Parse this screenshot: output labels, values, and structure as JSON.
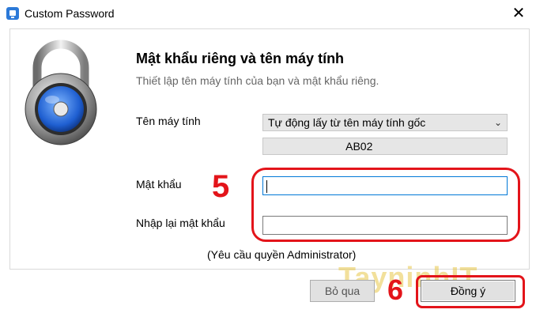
{
  "window": {
    "title": "Custom Password",
    "close_label": "✕"
  },
  "header": {
    "title": "Mật khẩu riêng và tên máy tính",
    "subtitle": "Thiết lập tên máy tính của bạn và mật khẩu riêng."
  },
  "form": {
    "computer_name_label": "Tên máy tính",
    "computer_name_option": "Tự động lấy từ tên máy tính gốc",
    "computer_name_value": "AB02",
    "password_label": "Mật khẩu",
    "password_value": "",
    "confirm_label": "Nhập lại mật khẩu",
    "confirm_value": "",
    "note": "(Yêu cầu quyền Administrator)"
  },
  "annotations": {
    "step5": "5",
    "step6": "6",
    "watermark": "TayninhIT",
    "color": "#e3141a"
  },
  "buttons": {
    "skip_label": "Bỏ qua",
    "ok_label": "Đồng ý"
  },
  "icons": {
    "app": "app-window-icon",
    "lock": "padlock-icon",
    "chevron": "chevron-down-icon"
  }
}
